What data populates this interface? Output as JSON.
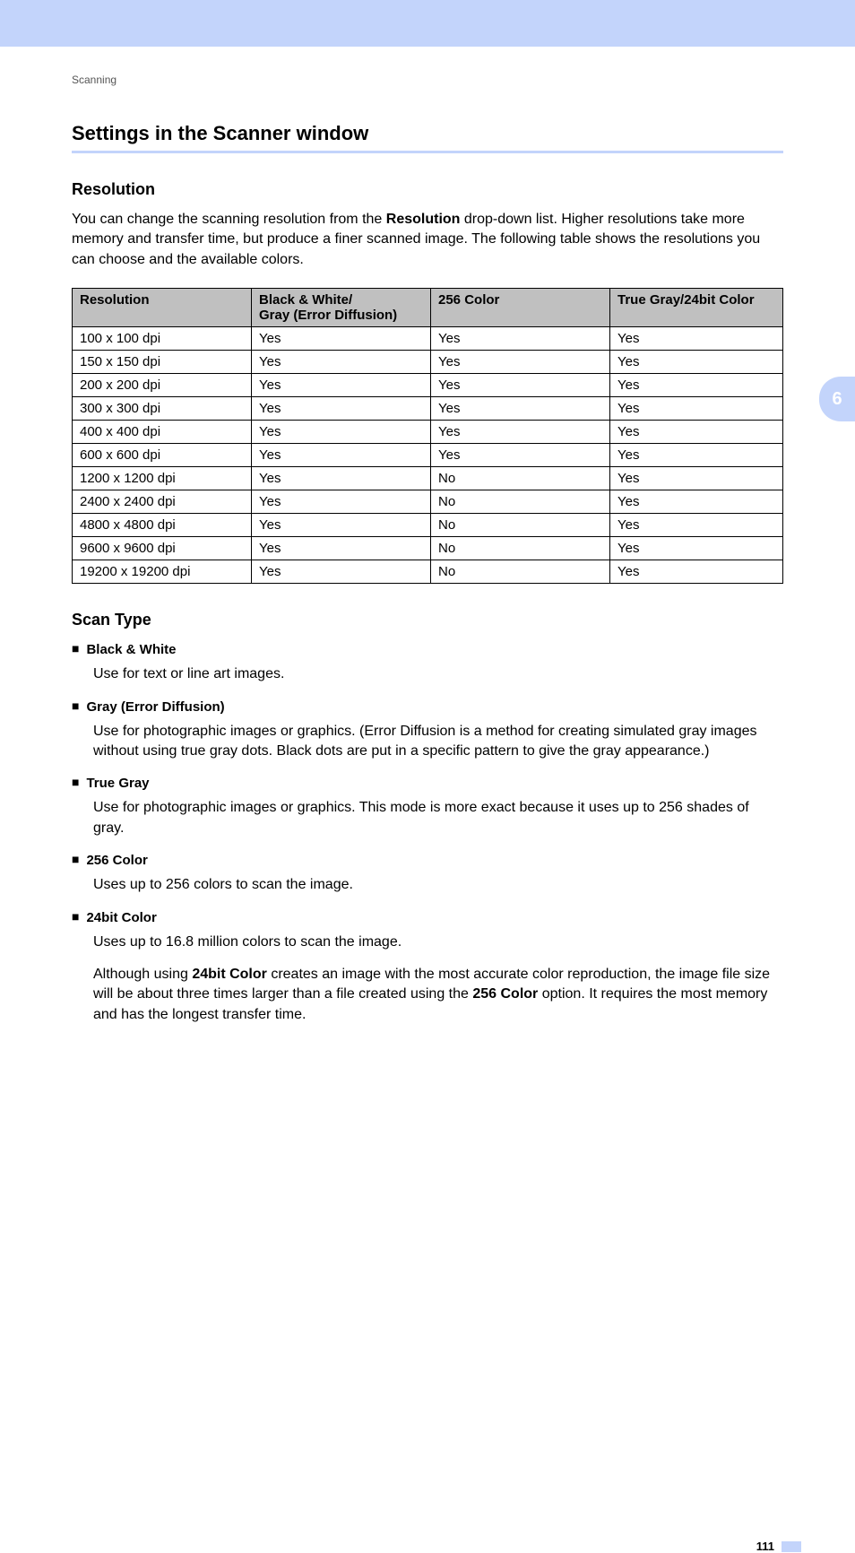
{
  "sectionLabel": "Scanning",
  "mainTitle": "Settings in the Scanner window",
  "sideTab": "6",
  "pageNumber": "111",
  "resolution": {
    "title": "Resolution",
    "bodyParts": [
      "You can change the scanning resolution from the ",
      "Resolution",
      " drop-down list. Higher resolutions take more memory and transfer time, but produce a finer scanned image. The following table shows the resolutions you can choose and the available colors."
    ],
    "table": {
      "headers": [
        "Resolution",
        "Black & White/\nGray (Error Diffusion)",
        "256 Color",
        "True Gray/24bit Color"
      ],
      "rows": [
        [
          "100 x 100 dpi",
          "Yes",
          "Yes",
          "Yes"
        ],
        [
          "150 x 150 dpi",
          "Yes",
          "Yes",
          "Yes"
        ],
        [
          "200 x 200 dpi",
          "Yes",
          "Yes",
          "Yes"
        ],
        [
          "300 x 300 dpi",
          "Yes",
          "Yes",
          "Yes"
        ],
        [
          "400 x 400 dpi",
          "Yes",
          "Yes",
          "Yes"
        ],
        [
          "600 x 600 dpi",
          "Yes",
          "Yes",
          "Yes"
        ],
        [
          "1200 x 1200 dpi",
          "Yes",
          "No",
          "Yes"
        ],
        [
          "2400 x 2400 dpi",
          "Yes",
          "No",
          "Yes"
        ],
        [
          "4800 x 4800 dpi",
          "Yes",
          "No",
          "Yes"
        ],
        [
          "9600 x 9600 dpi",
          "Yes",
          "No",
          "Yes"
        ],
        [
          "19200 x 19200 dpi",
          "Yes",
          "No",
          "Yes"
        ]
      ]
    }
  },
  "scanType": {
    "title": "Scan Type",
    "items": [
      {
        "label": "Black & White",
        "body": "Use for text or line art images."
      },
      {
        "label": "Gray (Error Diffusion)",
        "body": "Use for photographic images or graphics. (Error Diffusion is a method for creating simulated gray images without using true gray dots. Black dots are put in a specific pattern to give the gray appearance.)"
      },
      {
        "label": "True Gray",
        "body": "Use for photographic images or graphics. This mode is more exact because it uses up to 256 shades of gray."
      },
      {
        "label": "256 Color",
        "body": "Uses up to 256 colors to scan the image."
      },
      {
        "label": "24bit Color",
        "body": "Uses up to 16.8 million colors to scan the image.",
        "body2Parts": [
          "Although using ",
          "24bit Color",
          " creates an image with the most accurate color reproduction, the image file size will be about three times larger than a file created using the ",
          "256 Color",
          " option. It requires the most memory and has the longest transfer time."
        ]
      }
    ]
  },
  "chart_data": {
    "type": "table",
    "title": "Resolution vs color mode availability",
    "columns": [
      "Resolution",
      "Black & White/Gray (Error Diffusion)",
      "256 Color",
      "True Gray/24bit Color"
    ],
    "rows": [
      {
        "Resolution": "100 x 100 dpi",
        "Black & White/Gray (Error Diffusion)": "Yes",
        "256 Color": "Yes",
        "True Gray/24bit Color": "Yes"
      },
      {
        "Resolution": "150 x 150 dpi",
        "Black & White/Gray (Error Diffusion)": "Yes",
        "256 Color": "Yes",
        "True Gray/24bit Color": "Yes"
      },
      {
        "Resolution": "200 x 200 dpi",
        "Black & White/Gray (Error Diffusion)": "Yes",
        "256 Color": "Yes",
        "True Gray/24bit Color": "Yes"
      },
      {
        "Resolution": "300 x 300 dpi",
        "Black & White/Gray (Error Diffusion)": "Yes",
        "256 Color": "Yes",
        "True Gray/24bit Color": "Yes"
      },
      {
        "Resolution": "400 x 400 dpi",
        "Black & White/Gray (Error Diffusion)": "Yes",
        "256 Color": "Yes",
        "True Gray/24bit Color": "Yes"
      },
      {
        "Resolution": "600 x 600 dpi",
        "Black & White/Gray (Error Diffusion)": "Yes",
        "256 Color": "Yes",
        "True Gray/24bit Color": "Yes"
      },
      {
        "Resolution": "1200 x 1200 dpi",
        "Black & White/Gray (Error Diffusion)": "Yes",
        "256 Color": "No",
        "True Gray/24bit Color": "Yes"
      },
      {
        "Resolution": "2400 x 2400 dpi",
        "Black & White/Gray (Error Diffusion)": "Yes",
        "256 Color": "No",
        "True Gray/24bit Color": "Yes"
      },
      {
        "Resolution": "4800 x 4800 dpi",
        "Black & White/Gray (Error Diffusion)": "Yes",
        "256 Color": "No",
        "True Gray/24bit Color": "Yes"
      },
      {
        "Resolution": "9600 x 9600 dpi",
        "Black & White/Gray (Error Diffusion)": "Yes",
        "256 Color": "No",
        "True Gray/24bit Color": "Yes"
      },
      {
        "Resolution": "19200 x 19200 dpi",
        "Black & White/Gray (Error Diffusion)": "Yes",
        "256 Color": "No",
        "True Gray/24bit Color": "Yes"
      }
    ]
  }
}
